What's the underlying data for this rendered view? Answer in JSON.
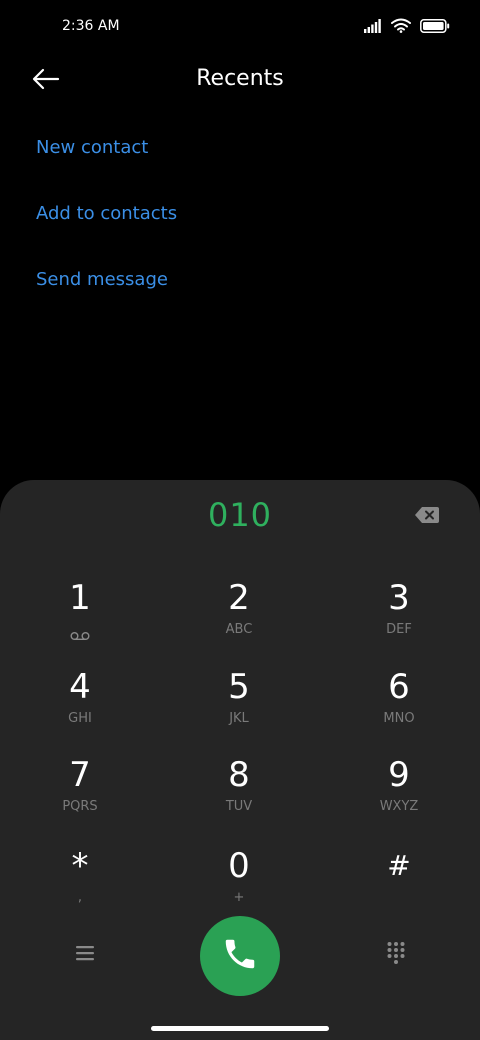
{
  "status_bar": {
    "time": "2:36 AM"
  },
  "header": {
    "title": "Recents"
  },
  "actions": [
    {
      "label": "New contact"
    },
    {
      "label": "Add to contacts"
    },
    {
      "label": "Send message"
    }
  ],
  "dialpad": {
    "number": "010",
    "keys": [
      {
        "digit": "1",
        "letters": ""
      },
      {
        "digit": "2",
        "letters": "ABC"
      },
      {
        "digit": "3",
        "letters": "DEF"
      },
      {
        "digit": "4",
        "letters": "GHI"
      },
      {
        "digit": "5",
        "letters": "JKL"
      },
      {
        "digit": "6",
        "letters": "MNO"
      },
      {
        "digit": "7",
        "letters": "PQRS"
      },
      {
        "digit": "8",
        "letters": "TUV"
      },
      {
        "digit": "9",
        "letters": "WXYZ"
      },
      {
        "digit": "*",
        "letters": ","
      },
      {
        "digit": "0",
        "letters": "+"
      },
      {
        "digit": "#",
        "letters": ""
      }
    ]
  },
  "icons": {
    "signal": "signal-icon",
    "wifi": "wifi-icon",
    "battery": "battery-icon",
    "back": "back-arrow-icon",
    "backspace": "backspace-icon",
    "voicemail": "voicemail-icon",
    "menu": "menu-icon",
    "call": "phone-icon",
    "dialpad": "dialpad-grid-icon"
  },
  "colors": {
    "link": "#3b8fe6",
    "number": "#2fb05e",
    "call_button": "#2aa154",
    "sheet": "#252525",
    "background": "#000000"
  }
}
